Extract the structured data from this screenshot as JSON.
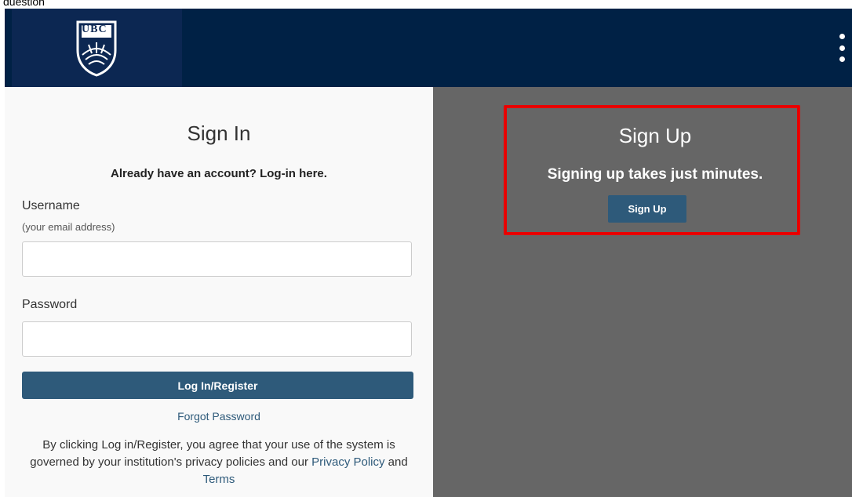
{
  "top_caption": "question",
  "header": {
    "logo_text": "UBC",
    "menu_icon": "kebab-menu-icon",
    "background": "#002145"
  },
  "signin": {
    "title": "Sign In",
    "subtitle": "Already have an account? Log-in here.",
    "username_label": "Username",
    "username_hint": "(your email address)",
    "username_value": "",
    "password_label": "Password",
    "password_value": "",
    "login_button": "Log In/Register",
    "forgot_link": "Forgot Password",
    "terms_text_1": "By clicking Log in/Register, you agree that your use of the system is governed by your institution's privacy policies and our ",
    "privacy_link": "Privacy Policy",
    "terms_and": " and ",
    "terms_link": "Terms"
  },
  "signup": {
    "title": "Sign Up",
    "subtitle": "Signing up takes just minutes.",
    "button": "Sign Up",
    "highlight_color": "#e80000"
  },
  "colors": {
    "accent": "#2e5a7a",
    "right_panel": "#666666"
  }
}
